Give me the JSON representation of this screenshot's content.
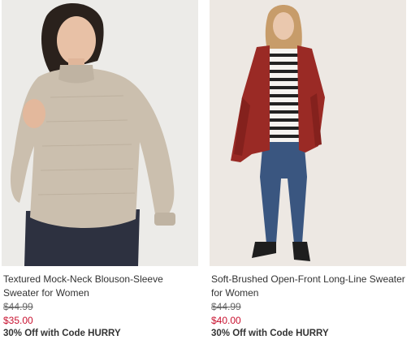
{
  "products": [
    {
      "title": "Textured Mock-Neck Blouson-Sleeve Sweater for Women",
      "original_price": "$44.99",
      "sale_price": "$35.00",
      "promo": "30% Off with Code HURRY",
      "image_alt": "Woman wearing an oatmeal textured mock-neck sweater"
    },
    {
      "title": "Soft-Brushed Open-Front Long-Line Sweater for Women",
      "original_price": "$44.99",
      "sale_price": "$40.00",
      "promo": "30% Off with Code HURRY",
      "image_alt": "Woman wearing a red long-line open-front cardigan over a striped top"
    }
  ],
  "colors": {
    "sale": "#c8102e",
    "text": "#333333",
    "background": "#ffffff"
  }
}
